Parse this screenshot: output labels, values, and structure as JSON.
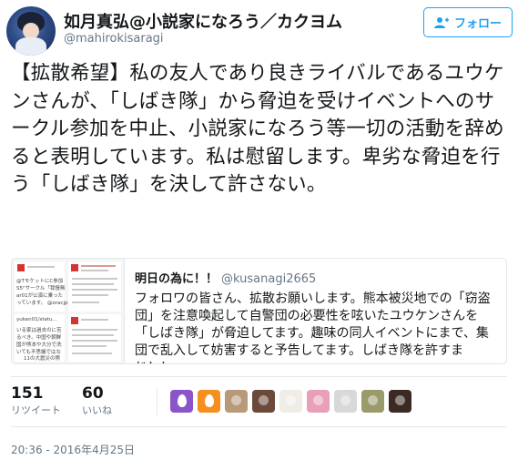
{
  "author": {
    "name": "如月真弘@小説家になろう／カクヨム",
    "handle": "@mahirokisaragi"
  },
  "follow_button": {
    "label": "フォロー",
    "icon": "add-user-icon"
  },
  "tweet": {
    "text": "【拡散希望】私の友人であり良きライバルであるユウケンさんが、「しばき隊」から脅迫を受けイベントへのサークル参加を中止、小説家になろう等一切の活動を辞めると表明しています。私は慰留します。卑劣な脅迫を行う「しばき隊」を決して許さない。"
  },
  "quoted": {
    "name": "明日の為に！！",
    "handle": "@kusanagi2665",
    "text": "フォロワの皆さん、拡散お願いします。熊本被災地での「窃盗団」を注意喚起して自警団の必要性を呟いたユウケンさんを「しばき隊」が脅迫してます。趣味の同人イベントにまで、集団で乱入して妨害すると予告してます。しばき隊を許すまじ！！",
    "thumbnail_texts": {
      "a1": "@TモケットにC参加",
      "a2": "S5\"サークル「我慢無",
      "a3": "ar01が公演に乗った",
      "a4": "っています。 @oracjp",
      "b1": "yuken01/statu…",
      "c1": "いる家は過去のに苦",
      "c2": "るべき。中国や朝鮮",
      "c3": "国が熊本や大分で洗",
      "c4": "いても不思議ではな",
      "c5": "11の大震災の際"
    }
  },
  "stats": {
    "retweets": {
      "count": "151",
      "label": "リツイート"
    },
    "likes": {
      "count": "60",
      "label": "いいね"
    }
  },
  "likers": [
    {
      "name": "liker-1",
      "color": "#8a55c8"
    },
    {
      "name": "liker-2",
      "color": "#f5901e"
    },
    {
      "name": "liker-3",
      "color": "#b89a7a"
    },
    {
      "name": "liker-4",
      "color": "#6b4a3a"
    },
    {
      "name": "liker-5",
      "color": "#f0ece6"
    },
    {
      "name": "liker-6",
      "color": "#e8a0b8"
    },
    {
      "name": "liker-7",
      "color": "#d8d8d8"
    },
    {
      "name": "liker-8",
      "color": "#9a9a6a"
    },
    {
      "name": "liker-9",
      "color": "#3a2a22"
    }
  ],
  "timestamp": "20:36 - 2016年4月25日",
  "colors": {
    "accent": "#1da1f2",
    "text": "#14171a",
    "secondary": "#657786",
    "border": "#e1e8ed"
  }
}
